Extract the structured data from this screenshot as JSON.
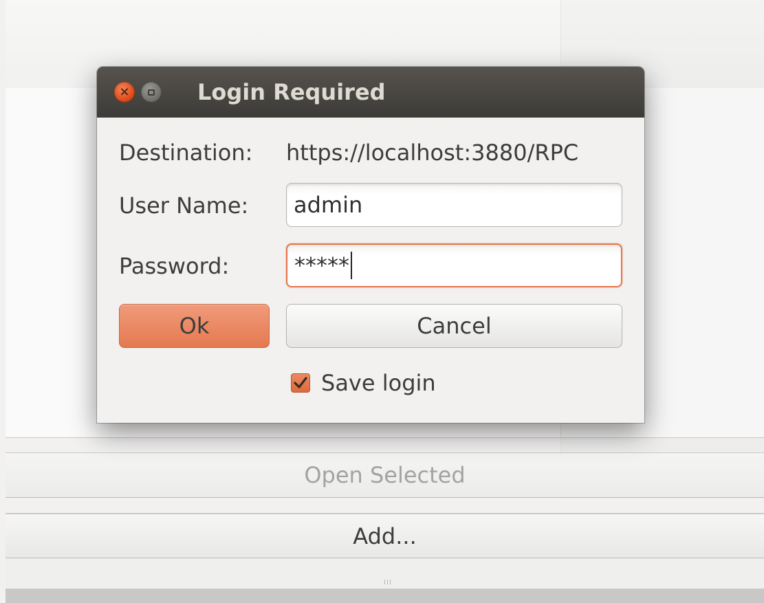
{
  "background": {
    "open_selected_label": "Open Selected",
    "add_label": "Add..."
  },
  "dialog": {
    "title": "Login Required",
    "destination_label": "Destination:",
    "destination_value": "https://localhost:3880/RPC",
    "username_label": "User Name:",
    "username_value": "admin",
    "password_label": "Password:",
    "password_value": "*****",
    "ok_label": "Ok",
    "cancel_label": "Cancel",
    "save_login_label": "Save login",
    "save_login_checked": true
  },
  "colors": {
    "accent": "#e5794f",
    "titlebar": "#3c3b37",
    "close_button": "#dd4814"
  },
  "icons": {
    "close": "close-icon",
    "maximize": "maximize-icon",
    "checkmark": "checkmark-icon",
    "grip": "resize-grip-icon"
  }
}
